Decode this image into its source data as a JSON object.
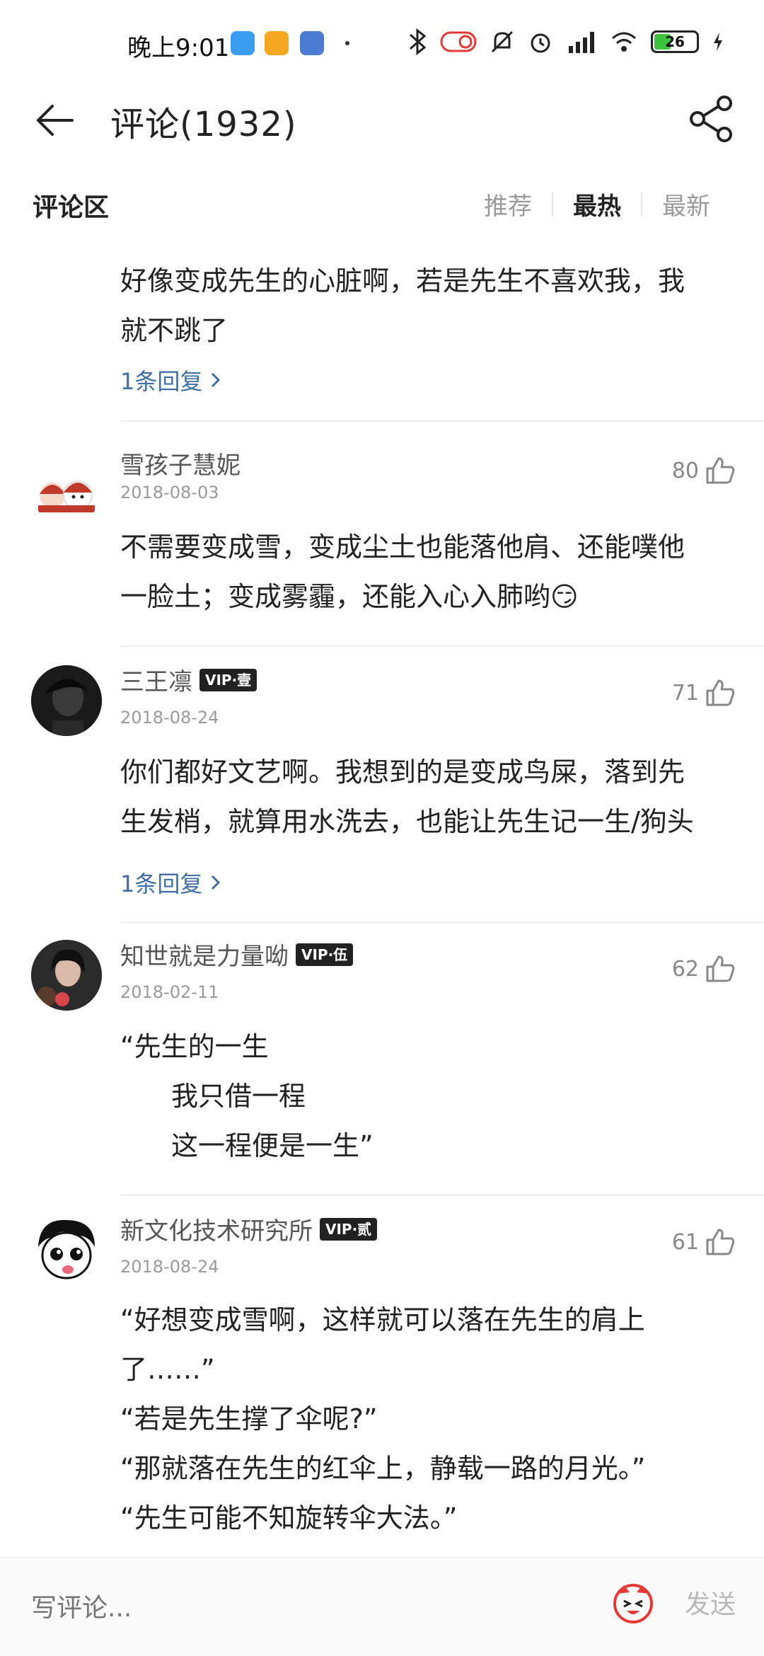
{
  "status_bar": {
    "time": "晚上9:01",
    "battery": "26",
    "colors": {
      "app1": "#3b9cf0",
      "app2": "#f5a623",
      "app3": "#4a7bd0"
    }
  },
  "header": {
    "title": "评论(1932)"
  },
  "section": {
    "title": "评论区",
    "sort_tabs": [
      "推荐",
      "最热",
      "最新"
    ],
    "active_tab": "最热"
  },
  "first_comment": {
    "text_lines": [
      "好像变成先生的心脏啊，若是先生不喜欢我，我",
      "就不跳了"
    ],
    "reply": "1条回复"
  },
  "comments": [
    {
      "user": "雪孩子慧妮",
      "date": "2018-08-03",
      "likes": "80",
      "text_lines": [
        "不需要变成雪，变成尘土也能落他肩、还能噗他",
        "一脸土；变成雾霾，还能入心入肺哟😏"
      ]
    },
    {
      "user": "三王凛",
      "vip": "VIP·壹",
      "date": "2018-08-24",
      "likes": "71",
      "text_lines": [
        "你们都好文艺啊。我想到的是变成鸟屎，落到先",
        "生发梢，就算用水洗去，也能让先生记一生/狗头"
      ],
      "reply": "1条回复"
    },
    {
      "user": "知世就是力量呦",
      "vip": "VIP·伍",
      "date": "2018-02-11",
      "likes": "62",
      "text_lines": [
        "“先生的一生",
        "我只借一程",
        "这一程便是一生”"
      ]
    },
    {
      "user": "新文化技术研究所",
      "vip": "VIP·贰",
      "date": "2018-08-24",
      "likes": "61",
      "text_lines": [
        "“好想变成雪啊，这样就可以落在先生的肩上",
        "了……”",
        "“若是先生撑了伞呢?”",
        "“那就落在先生的红伞上，静载一路的月光。”",
        "“先生可能不知旋转伞大法。”"
      ]
    }
  ],
  "bottom_bar": {
    "placeholder": "写评论...",
    "send": "发送"
  }
}
